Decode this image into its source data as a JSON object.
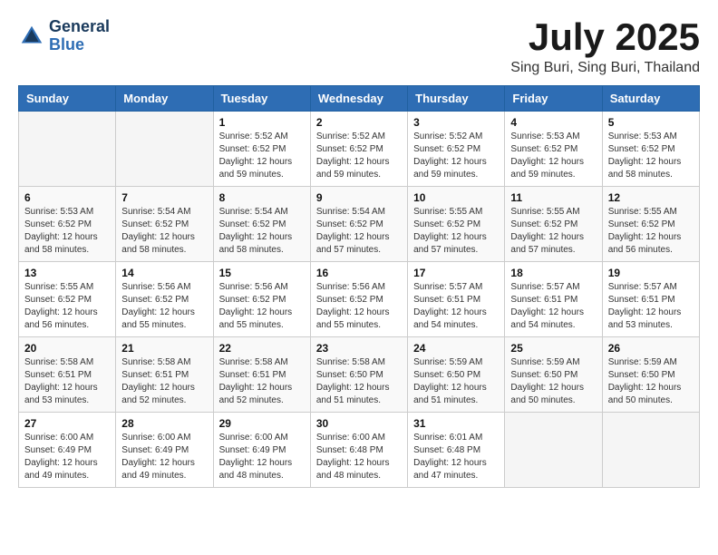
{
  "header": {
    "logo_line1": "General",
    "logo_line2": "Blue",
    "month": "July 2025",
    "location": "Sing Buri, Sing Buri, Thailand"
  },
  "weekdays": [
    "Sunday",
    "Monday",
    "Tuesday",
    "Wednesday",
    "Thursday",
    "Friday",
    "Saturday"
  ],
  "weeks": [
    [
      {
        "day": "",
        "info": ""
      },
      {
        "day": "",
        "info": ""
      },
      {
        "day": "1",
        "info": "Sunrise: 5:52 AM\nSunset: 6:52 PM\nDaylight: 12 hours and 59 minutes."
      },
      {
        "day": "2",
        "info": "Sunrise: 5:52 AM\nSunset: 6:52 PM\nDaylight: 12 hours and 59 minutes."
      },
      {
        "day": "3",
        "info": "Sunrise: 5:52 AM\nSunset: 6:52 PM\nDaylight: 12 hours and 59 minutes."
      },
      {
        "day": "4",
        "info": "Sunrise: 5:53 AM\nSunset: 6:52 PM\nDaylight: 12 hours and 59 minutes."
      },
      {
        "day": "5",
        "info": "Sunrise: 5:53 AM\nSunset: 6:52 PM\nDaylight: 12 hours and 58 minutes."
      }
    ],
    [
      {
        "day": "6",
        "info": "Sunrise: 5:53 AM\nSunset: 6:52 PM\nDaylight: 12 hours and 58 minutes."
      },
      {
        "day": "7",
        "info": "Sunrise: 5:54 AM\nSunset: 6:52 PM\nDaylight: 12 hours and 58 minutes."
      },
      {
        "day": "8",
        "info": "Sunrise: 5:54 AM\nSunset: 6:52 PM\nDaylight: 12 hours and 58 minutes."
      },
      {
        "day": "9",
        "info": "Sunrise: 5:54 AM\nSunset: 6:52 PM\nDaylight: 12 hours and 57 minutes."
      },
      {
        "day": "10",
        "info": "Sunrise: 5:55 AM\nSunset: 6:52 PM\nDaylight: 12 hours and 57 minutes."
      },
      {
        "day": "11",
        "info": "Sunrise: 5:55 AM\nSunset: 6:52 PM\nDaylight: 12 hours and 57 minutes."
      },
      {
        "day": "12",
        "info": "Sunrise: 5:55 AM\nSunset: 6:52 PM\nDaylight: 12 hours and 56 minutes."
      }
    ],
    [
      {
        "day": "13",
        "info": "Sunrise: 5:55 AM\nSunset: 6:52 PM\nDaylight: 12 hours and 56 minutes."
      },
      {
        "day": "14",
        "info": "Sunrise: 5:56 AM\nSunset: 6:52 PM\nDaylight: 12 hours and 55 minutes."
      },
      {
        "day": "15",
        "info": "Sunrise: 5:56 AM\nSunset: 6:52 PM\nDaylight: 12 hours and 55 minutes."
      },
      {
        "day": "16",
        "info": "Sunrise: 5:56 AM\nSunset: 6:52 PM\nDaylight: 12 hours and 55 minutes."
      },
      {
        "day": "17",
        "info": "Sunrise: 5:57 AM\nSunset: 6:51 PM\nDaylight: 12 hours and 54 minutes."
      },
      {
        "day": "18",
        "info": "Sunrise: 5:57 AM\nSunset: 6:51 PM\nDaylight: 12 hours and 54 minutes."
      },
      {
        "day": "19",
        "info": "Sunrise: 5:57 AM\nSunset: 6:51 PM\nDaylight: 12 hours and 53 minutes."
      }
    ],
    [
      {
        "day": "20",
        "info": "Sunrise: 5:58 AM\nSunset: 6:51 PM\nDaylight: 12 hours and 53 minutes."
      },
      {
        "day": "21",
        "info": "Sunrise: 5:58 AM\nSunset: 6:51 PM\nDaylight: 12 hours and 52 minutes."
      },
      {
        "day": "22",
        "info": "Sunrise: 5:58 AM\nSunset: 6:51 PM\nDaylight: 12 hours and 52 minutes."
      },
      {
        "day": "23",
        "info": "Sunrise: 5:58 AM\nSunset: 6:50 PM\nDaylight: 12 hours and 51 minutes."
      },
      {
        "day": "24",
        "info": "Sunrise: 5:59 AM\nSunset: 6:50 PM\nDaylight: 12 hours and 51 minutes."
      },
      {
        "day": "25",
        "info": "Sunrise: 5:59 AM\nSunset: 6:50 PM\nDaylight: 12 hours and 50 minutes."
      },
      {
        "day": "26",
        "info": "Sunrise: 5:59 AM\nSunset: 6:50 PM\nDaylight: 12 hours and 50 minutes."
      }
    ],
    [
      {
        "day": "27",
        "info": "Sunrise: 6:00 AM\nSunset: 6:49 PM\nDaylight: 12 hours and 49 minutes."
      },
      {
        "day": "28",
        "info": "Sunrise: 6:00 AM\nSunset: 6:49 PM\nDaylight: 12 hours and 49 minutes."
      },
      {
        "day": "29",
        "info": "Sunrise: 6:00 AM\nSunset: 6:49 PM\nDaylight: 12 hours and 48 minutes."
      },
      {
        "day": "30",
        "info": "Sunrise: 6:00 AM\nSunset: 6:48 PM\nDaylight: 12 hours and 48 minutes."
      },
      {
        "day": "31",
        "info": "Sunrise: 6:01 AM\nSunset: 6:48 PM\nDaylight: 12 hours and 47 minutes."
      },
      {
        "day": "",
        "info": ""
      },
      {
        "day": "",
        "info": ""
      }
    ]
  ]
}
